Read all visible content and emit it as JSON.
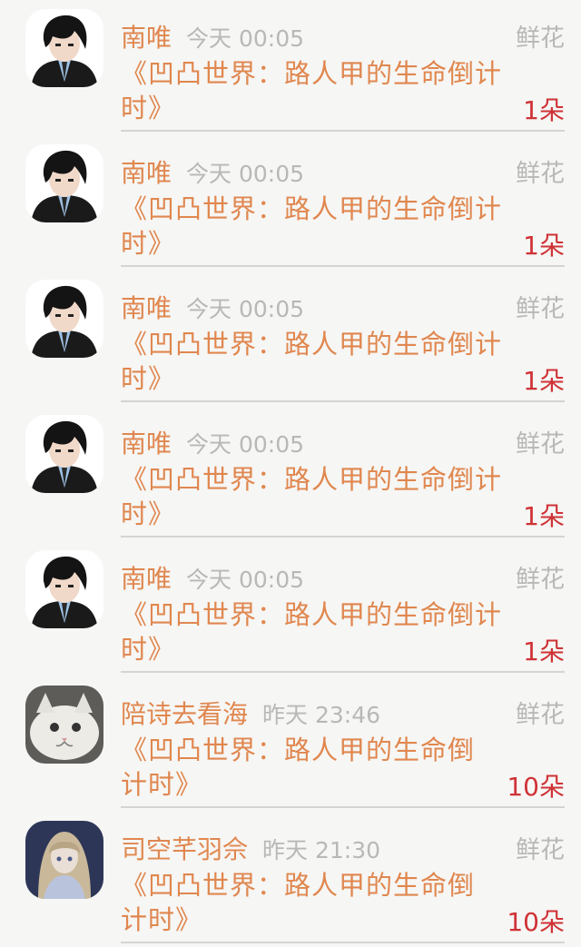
{
  "gift_list": [
    {
      "name": "南唯",
      "time": "今天 00:05",
      "gift_type": "鲜花",
      "book": "《凹凸世界：路人甲的生命倒计时》",
      "amount": "1朵",
      "avatar": "anime-boy-avatar"
    },
    {
      "name": "南唯",
      "time": "今天 00:05",
      "gift_type": "鲜花",
      "book": "《凹凸世界：路人甲的生命倒计时》",
      "amount": "1朵",
      "avatar": "anime-boy-avatar"
    },
    {
      "name": "南唯",
      "time": "今天 00:05",
      "gift_type": "鲜花",
      "book": "《凹凸世界：路人甲的生命倒计时》",
      "amount": "1朵",
      "avatar": "anime-boy-avatar"
    },
    {
      "name": "南唯",
      "time": "今天 00:05",
      "gift_type": "鲜花",
      "book": "《凹凸世界：路人甲的生命倒计时》",
      "amount": "1朵",
      "avatar": "anime-boy-avatar"
    },
    {
      "name": "南唯",
      "time": "今天 00:05",
      "gift_type": "鲜花",
      "book": "《凹凸世界：路人甲的生命倒计时》",
      "amount": "1朵",
      "avatar": "anime-boy-avatar"
    },
    {
      "name": "陪诗去看海",
      "time": "昨天 23:46",
      "gift_type": "鲜花",
      "book": "《凹凸世界：路人甲的生命倒计时》",
      "amount": "10朵",
      "avatar": "cat-avatar"
    },
    {
      "name": "司空芊羽佘",
      "time": "昨天 21:30",
      "gift_type": "鲜花",
      "book": "《凹凸世界：路人甲的生命倒计时》",
      "amount": "10朵",
      "avatar": "anime-girl-avatar"
    }
  ],
  "colors": {
    "accent": "#e0874f",
    "muted": "#b8b8b8",
    "amount": "#cf3236",
    "background": "#f6f6f4"
  }
}
